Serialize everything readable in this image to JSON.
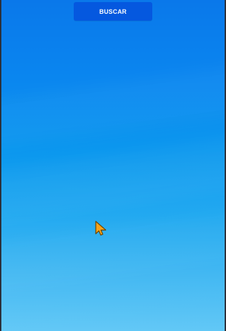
{
  "header": {
    "search_button_label": "BUSCAR"
  },
  "pointer": {
    "icon": "cursor-arrow"
  },
  "colors": {
    "search_button_bg": "#0558df",
    "background_top": "#0a78ea",
    "background_bottom": "#62c8f6",
    "cursor_fill": "#f6a21a",
    "cursor_stroke": "#6b4500"
  }
}
